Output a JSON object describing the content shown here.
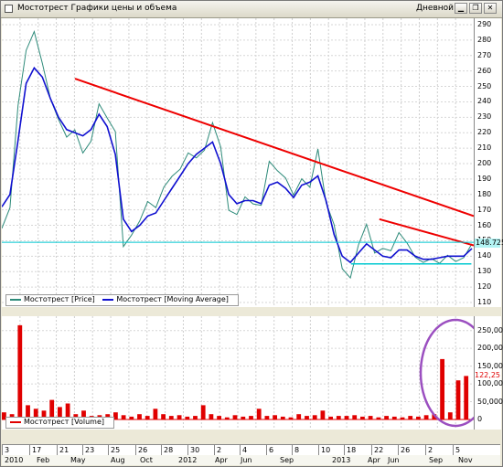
{
  "window": {
    "title": "Мостотрест Графики цены и объема",
    "period": "Дневной",
    "buttons": [
      "minimize",
      "restore",
      "close"
    ]
  },
  "legend_price": [
    {
      "label": "Мостотрест [Price]",
      "color": "#2e8b7a"
    },
    {
      "label": "Мостотрест [Moving Average]",
      "color": "#1010d0"
    }
  ],
  "legend_volume": [
    {
      "label": "Мостотрест [Volume]",
      "color": "#e00000"
    }
  ],
  "price_axis": {
    "ticks": [
      "290",
      "280",
      "270",
      "260",
      "250",
      "240",
      "230",
      "220",
      "210",
      "200",
      "190",
      "180",
      "170",
      "160",
      "150",
      "140",
      "130",
      "120",
      "110"
    ],
    "current": "148.725"
  },
  "volume_axis": {
    "ticks": [
      "250,000",
      "200,000",
      "150,000",
      "100,000",
      "50,000",
      "0"
    ],
    "current": "122,25"
  },
  "date_axis": {
    "top": [
      "3",
      "17",
      "21",
      "23",
      "25",
      "26",
      "28",
      "30",
      "2",
      "4",
      "6",
      "8",
      "10",
      "18",
      "22",
      "26",
      "2",
      "5"
    ],
    "bottom": [
      "2010",
      "Feb",
      "May",
      "Aug",
      "Oct",
      "2012",
      "Apr",
      "Jun",
      "Sep",
      "2013",
      "Apr",
      "Jun",
      "Sep",
      "Nov"
    ]
  },
  "chart_data": [
    {
      "type": "line",
      "ylim": [
        110,
        290
      ],
      "series": [
        {
          "name": "Мостотрест [Price]",
          "color": "#2e8b7a",
          "values": [
            158,
            170,
            235,
            270,
            282,
            262,
            240,
            228,
            218,
            224,
            210,
            218,
            242,
            232,
            222,
            146,
            152,
            160,
            172,
            168,
            182,
            190,
            196,
            208,
            206,
            212,
            230,
            214,
            172,
            168,
            178,
            172,
            170,
            198,
            192,
            188,
            178,
            190,
            186,
            212,
            178,
            164,
            135,
            128,
            148,
            160,
            140,
            142,
            140,
            152,
            146,
            138,
            136,
            140,
            138,
            144,
            140,
            142,
            150
          ]
        },
        {
          "name": "Мостотрест [Moving Average]",
          "color": "#1010d0",
          "values": [
            172,
            180,
            215,
            252,
            262,
            256,
            242,
            230,
            222,
            220,
            218,
            222,
            232,
            224,
            206,
            164,
            156,
            160,
            166,
            168,
            176,
            184,
            192,
            200,
            206,
            210,
            214,
            200,
            180,
            174,
            176,
            176,
            174,
            186,
            188,
            184,
            178,
            186,
            188,
            192,
            176,
            154,
            140,
            136,
            142,
            148,
            144,
            140,
            139,
            144,
            144,
            140,
            138,
            138,
            139,
            140,
            140,
            140,
            145
          ]
        }
      ],
      "annotations": [
        {
          "type": "trendline",
          "color": "#ee0000",
          "from": [
            0.155,
            255
          ],
          "to": [
            1.0,
            166
          ]
        },
        {
          "type": "trendline",
          "color": "#ee0000",
          "from": [
            0.8,
            164
          ],
          "to": [
            1.0,
            147
          ]
        },
        {
          "type": "hline",
          "color": "#00c8d0",
          "y": 149
        },
        {
          "type": "segment",
          "color": "#00c8d0",
          "from": [
            0.74,
            135
          ],
          "to": [
            0.995,
            135
          ]
        }
      ]
    },
    {
      "type": "bar",
      "ylim": [
        0,
        275000
      ],
      "series": [
        {
          "name": "Мостотрест [Volume]",
          "color": "#e00000",
          "values": [
            20000,
            15000,
            265000,
            40000,
            30000,
            25000,
            55000,
            35000,
            45000,
            15000,
            25000,
            10000,
            12000,
            15000,
            20000,
            12000,
            8000,
            15000,
            10000,
            30000,
            15000,
            10000,
            12000,
            8000,
            10000,
            40000,
            15000,
            10000,
            6000,
            12000,
            8000,
            10000,
            30000,
            10000,
            12000,
            8000,
            6000,
            15000,
            10000,
            12000,
            25000,
            8000,
            10000,
            10000,
            12000,
            8000,
            10000,
            6000,
            10000,
            8000,
            6000,
            10000,
            8000,
            12000,
            15000,
            170000,
            20000,
            110000,
            122250
          ]
        }
      ],
      "annotations": [
        {
          "type": "ellipse",
          "color": "#9b4fc0",
          "label": ""
        }
      ]
    }
  ]
}
